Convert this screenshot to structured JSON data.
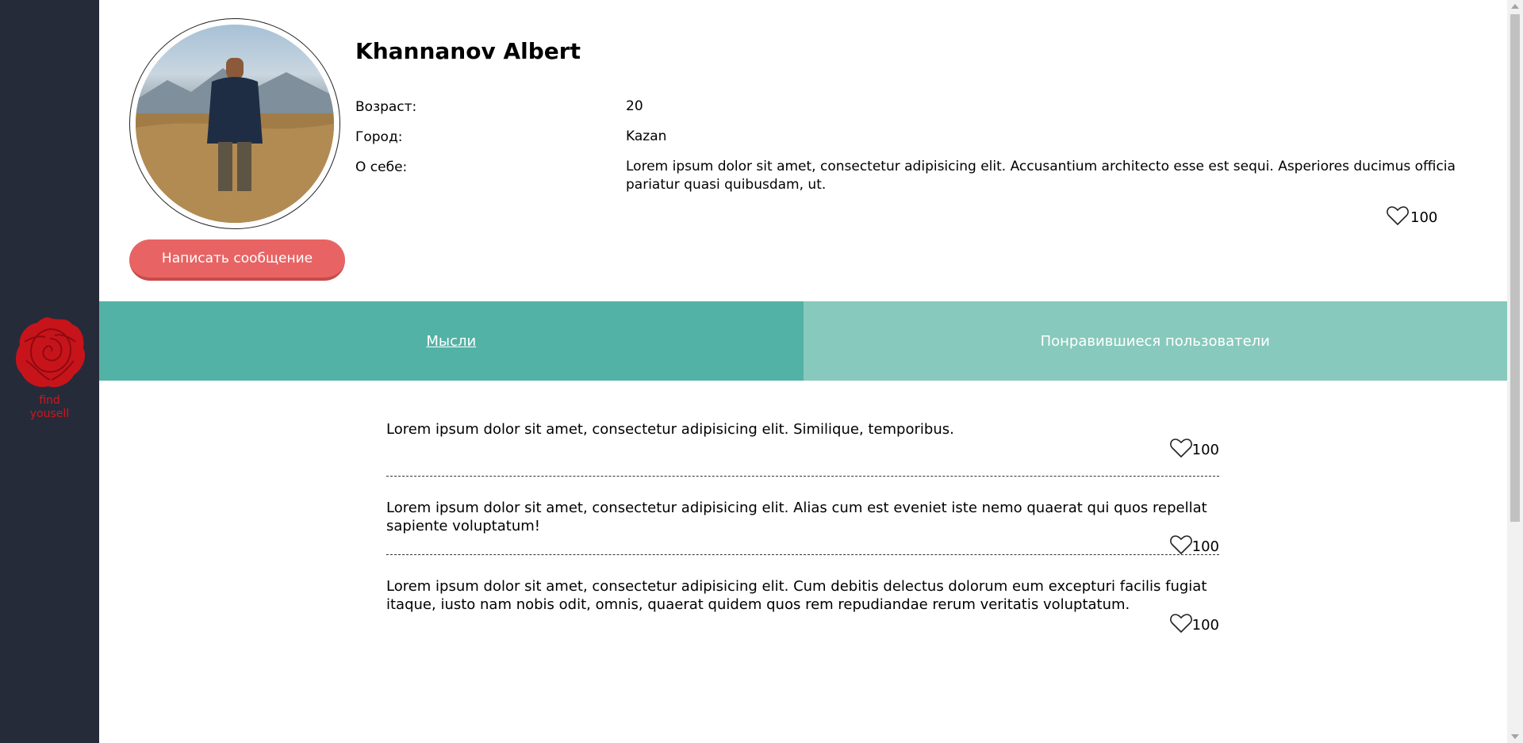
{
  "brand": {
    "logo_icon": "rose-icon",
    "logo_text_line1": "find",
    "logo_text_line2": "yousell",
    "accent": "#d4151b"
  },
  "profile": {
    "name": "Khannanov Albert",
    "age_label": "Возраст:",
    "age_value": "20",
    "city_label": "Город:",
    "city_value": "Kazan",
    "about_label": "О себе:",
    "about_value": "Lorem ipsum dolor sit amet, consectetur adipisicing elit. Accusantium architecto esse est sequi. Asperiores ducimus officia pariatur quasi quibusdam, ut.",
    "likes": "100",
    "message_button": "Написать сообщение"
  },
  "tabs": [
    {
      "label": "Мысли",
      "active": true
    },
    {
      "label": "Понравившиеся пользователи",
      "active": false
    }
  ],
  "thoughts": [
    {
      "text": "Lorem ipsum dolor sit amet, consectetur adipisicing elit. Similique, temporibus.",
      "likes": "100"
    },
    {
      "text": "Lorem ipsum dolor sit amet, consectetur adipisicing elit. Alias cum est eveniet iste nemo quaerat qui quos repellat sapiente voluptatum!",
      "likes": "100"
    },
    {
      "text": "Lorem ipsum dolor sit amet, consectetur adipisicing elit. Cum debitis delectus dolorum eum excepturi facilis fugiat itaque, iusto nam nobis odit, omnis, quaerat quidem quos rem repudiandae rerum veritatis voluptatum.",
      "likes": "100"
    }
  ],
  "colors": {
    "sidebar": "#262b3a",
    "tab_active": "#52b2a5",
    "tab_inactive": "#88c9bd",
    "button": "#e86464"
  }
}
